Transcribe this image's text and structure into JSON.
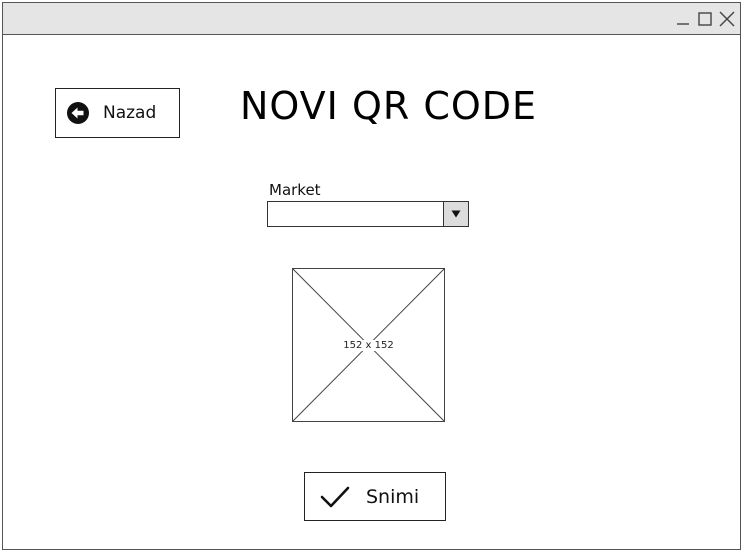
{
  "window": {
    "controls": {
      "minimize_icon": "minimize-icon",
      "maximize_icon": "maximize-icon",
      "close_icon": "close-icon"
    }
  },
  "header": {
    "back_button_label": "Nazad",
    "back_icon": "arrow-left-circle-icon",
    "title": "NOVI QR CODE"
  },
  "form": {
    "market_label": "Market",
    "market_value": "",
    "dropdown_icon": "triangle-down-icon"
  },
  "qr_image": {
    "size_label": "152 x 152"
  },
  "actions": {
    "save_label": "Snimi",
    "save_icon": "checkmark-icon"
  },
  "colors": {
    "titlebar_bg": "#e5e5e5",
    "border": "#555555",
    "select_arrow_bg": "#dcdcdc"
  }
}
